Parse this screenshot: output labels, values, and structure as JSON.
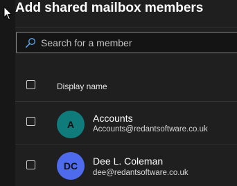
{
  "panel": {
    "title": "Add shared mailbox members"
  },
  "search": {
    "placeholder": "Search for a member",
    "value": ""
  },
  "table": {
    "columns": [
      "Display name"
    ],
    "rows": [
      {
        "initials": "A",
        "name": "Accounts",
        "email": "Accounts@redantsoftware.co.uk",
        "avatar_color": "#0f7b7b",
        "initials_color": "#111111"
      },
      {
        "initials": "DC",
        "name": "Dee L. Coleman",
        "email": "dee@redantsoftware.co.uk",
        "avatar_color": "#4f6bed",
        "initials_color": "#111111"
      }
    ]
  },
  "icons": {
    "cursor": "mouse-pointer-icon",
    "search": "search-icon",
    "select_all": "checkbox-icon"
  },
  "colors": {
    "background": "#1f1f1f",
    "search_icon": "#5aa2e6"
  }
}
